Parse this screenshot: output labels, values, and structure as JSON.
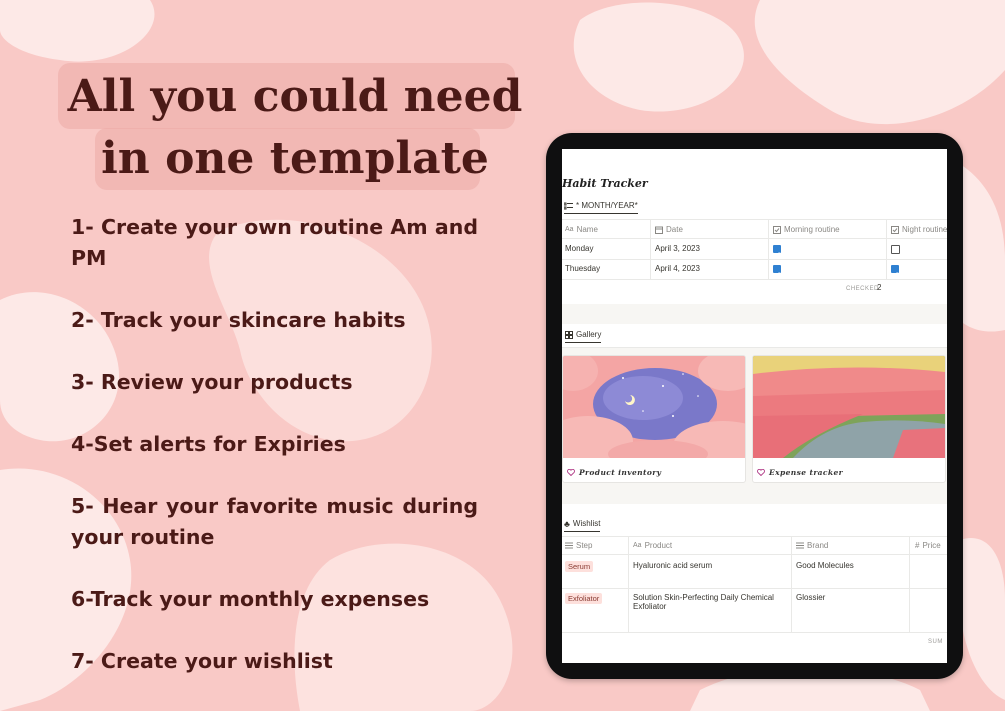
{
  "headline": {
    "line1": "All you could need",
    "line2": "in one template"
  },
  "features": [
    "1- Create your own routine Am and PM",
    "2- Track your skincare habits",
    "3- Review your products",
    "4-Set alerts for Expiries",
    "5- Hear your favorite music during your routine",
    "6-Track your monthly expenses",
    "7- Create your wishlist"
  ],
  "colors": {
    "background": "#f9c9c6",
    "blob": "#fde9e7",
    "text": "#4b1a17",
    "checkbox": "#2f80d1",
    "tag": "#fde0dc"
  },
  "habit_tracker": {
    "title": "Habit Tracker",
    "view_icon": "checklist-icon",
    "view_label": "* MONTH/YEAR*",
    "columns": [
      {
        "icon": "text-icon",
        "label": "Name"
      },
      {
        "icon": "calendar-icon",
        "label": "Date"
      },
      {
        "icon": "checkbox-icon",
        "label": "Morning routine"
      },
      {
        "icon": "checkbox-icon",
        "label": "Night routine"
      }
    ],
    "rows": [
      {
        "name": "Monday",
        "date": "April 3, 2023",
        "morning": true,
        "night": false
      },
      {
        "name": "Thuesday",
        "date": "April 4, 2023",
        "morning": true,
        "night": true
      }
    ],
    "footer_label": "CHECKED",
    "footer_value": "2"
  },
  "gallery": {
    "view_icon": "gallery-icon",
    "view_label": "Gallery",
    "cards": [
      {
        "icon": "heart-icon",
        "label": "Product inventory"
      },
      {
        "icon": "heart-icon",
        "label": "Expense tracker"
      }
    ]
  },
  "wishlist": {
    "view_icon": "clover-icon",
    "view_label": "Wishlist",
    "columns": [
      {
        "icon": "list-icon",
        "label": "Step"
      },
      {
        "icon": "text-icon",
        "label": "Product"
      },
      {
        "icon": "list-icon",
        "label": "Brand"
      },
      {
        "icon": "hash-icon",
        "label": "Price"
      }
    ],
    "rows": [
      {
        "step": "Serum",
        "product": "Hyaluronic acid serum",
        "product_line2": "",
        "brand": "Good Molecules"
      },
      {
        "step": "Exfoliator",
        "product": "Solution Skin-Perfecting Daily Chemical",
        "product_line2": "Exfoliator",
        "brand": "Glossier"
      }
    ],
    "footer_label": "SUM"
  }
}
